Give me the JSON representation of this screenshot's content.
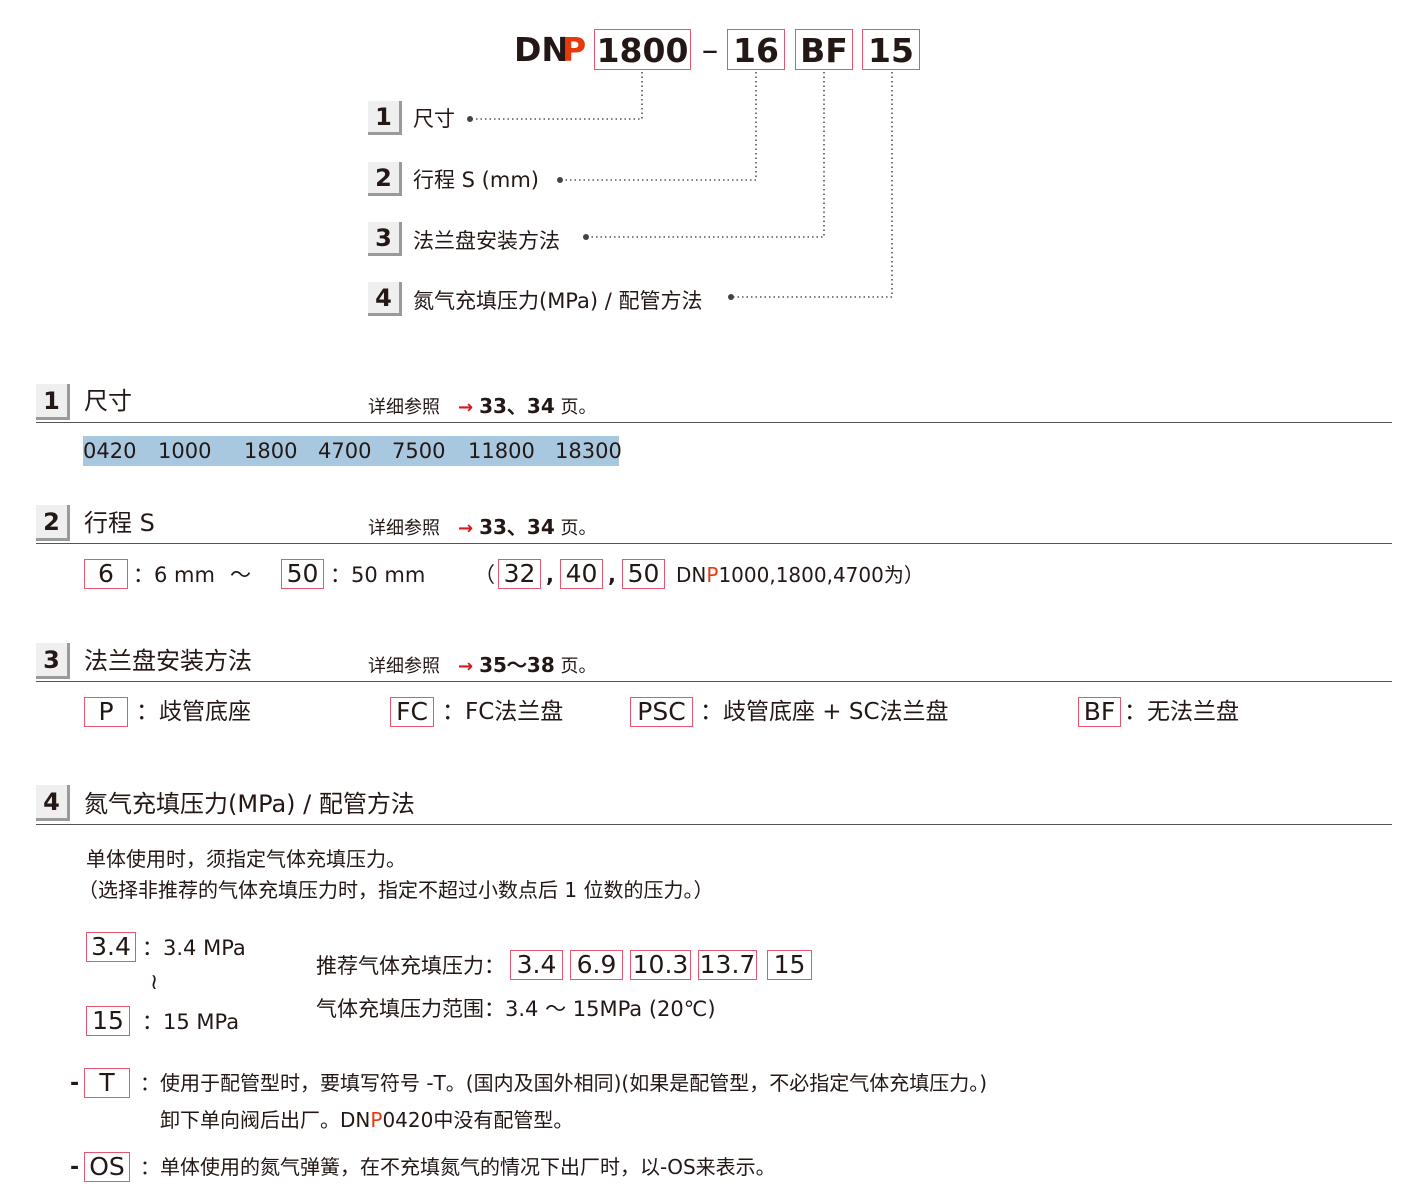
{
  "code": {
    "prefix_dn": "DN",
    "prefix_p": "P",
    "size": "1800",
    "dash": "–",
    "stroke": "16",
    "flange": "BF",
    "pressure": "15"
  },
  "legend": [
    {
      "num": "1",
      "label": "尺寸"
    },
    {
      "num": "2",
      "label": "行程  S (mm)"
    },
    {
      "num": "3",
      "label": "法兰盘安装方法"
    },
    {
      "num": "4",
      "label": "氮气充填压力(MPa) / 配管方法"
    }
  ],
  "sections": {
    "s1": {
      "num": "1",
      "title": "尺寸",
      "ref_label": "详细参照",
      "arrow": "→",
      "ref_pages": "33、34",
      "ref_suffix": "页。",
      "sizes": [
        "0420",
        "1000",
        "1800",
        "4700",
        "7500",
        "11800",
        "18300"
      ]
    },
    "s2": {
      "num": "2",
      "title": "行程  S",
      "ref_label": "详细参照",
      "arrow": "→",
      "ref_pages": "33、34",
      "ref_suffix": "页。",
      "min_code": "6",
      "min_text": "：6 mm",
      "tilde": "～",
      "max_code": "50",
      "max_text": "：50 mm",
      "open_paren": "（",
      "extra_codes": [
        "32",
        "40",
        "50"
      ],
      "comma": ",",
      "note_dn": "DN",
      "note_p": "P",
      "note_rest": "1000,1800,4700为）"
    },
    "s3": {
      "num": "3",
      "title": "法兰盘安装方法",
      "ref_label": "详细参照",
      "arrow": "→",
      "ref_pages": "35～38",
      "ref_suffix": "页。",
      "options": [
        {
          "code": "P",
          "desc": "：歧管底座"
        },
        {
          "code": "FC",
          "desc": "：FC法兰盘"
        },
        {
          "code": "PSC",
          "desc": "：歧管底座 + SC法兰盘"
        },
        {
          "code": "BF",
          "desc": "：无法兰盘"
        }
      ]
    },
    "s4": {
      "num": "4",
      "title": "氮气充填压力(MPa) / 配管方法",
      "note1": "单体使用时，须指定气体充填压力。",
      "note2": "（选择非推荐的气体充填压力时，指定不超过小数点后 1 位数的压力。）",
      "min_code": "3.4",
      "min_text": "：3.4 MPa",
      "range_mark": "≀",
      "max_code": "15",
      "max_text": "：15 MPa",
      "recommended_label": "推荐气体充填压力：",
      "recommended": [
        "3.4",
        "6.9",
        "10.3",
        "13.7",
        "15"
      ],
      "range_text": "气体充填压力范围：3.4 ～ 15MPa (20℃)",
      "t_dash": "-",
      "t_code": "T",
      "t_line1": "：使用于配管型时，要填写符号 -T。(国内及国外相同)(如果是配管型，不必指定气体充填压力。)",
      "t_line2_a": "卸下单向阀后出厂。DN",
      "t_line2_p": "P",
      "t_line2_b": "0420中没有配管型。",
      "os_dash": "-",
      "os_code": "OS",
      "os_line": "：单体使用的氮气弹簧，在不充填氮气的情况下出厂时，以-OS来表示。"
    }
  },
  "colors": {
    "accent_red": "#e8380d",
    "box_border": "#e8556e",
    "size_bg": "#a8c8df",
    "arrow_red": "#d71920"
  }
}
